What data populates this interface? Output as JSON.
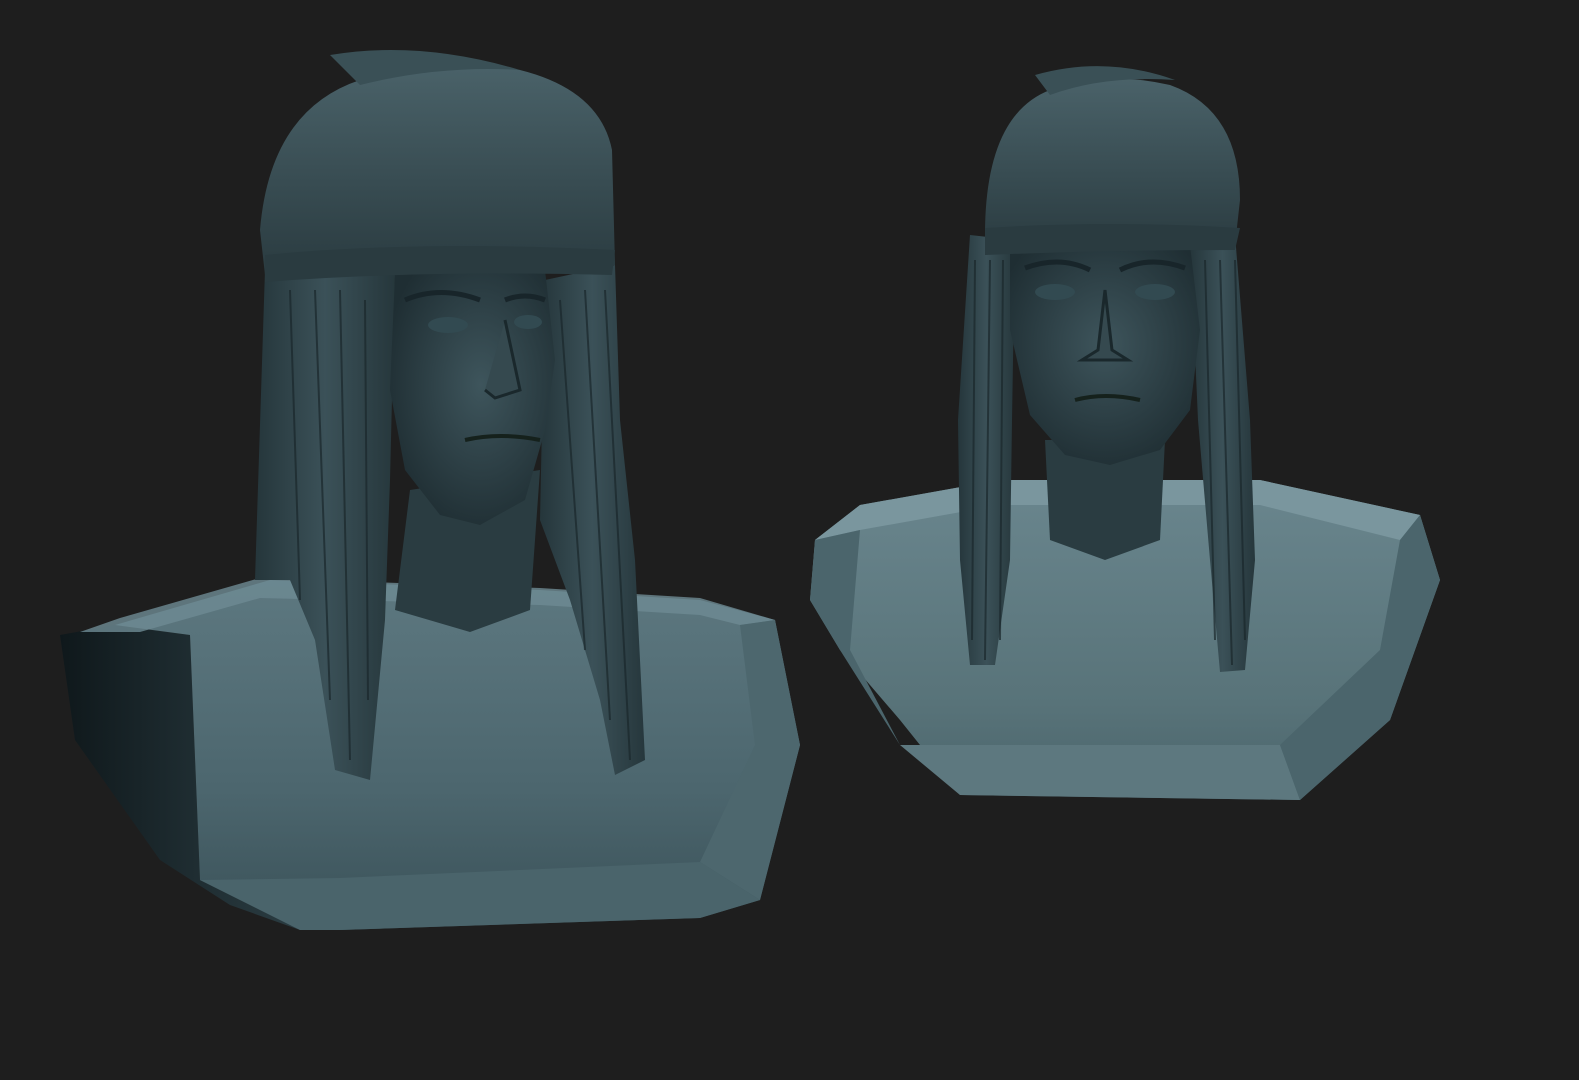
{
  "scene": {
    "background_color": "#1e1e1e",
    "clay_dark": "#1f2e33",
    "clay_mid": "#3e555c",
    "clay_light": "#6d8a92",
    "models": [
      {
        "name": "bust-three-quarter-view",
        "view": "three-quarter"
      },
      {
        "name": "bust-front-view",
        "view": "front"
      }
    ]
  }
}
